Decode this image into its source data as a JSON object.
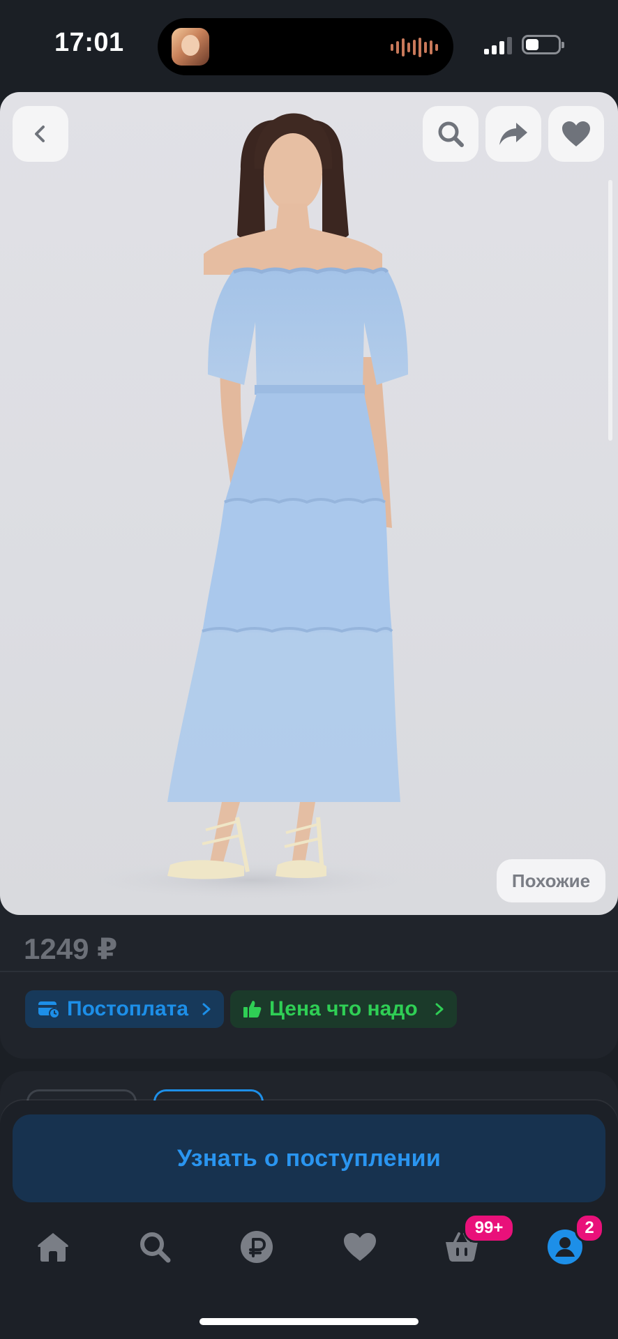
{
  "status_bar": {
    "time": "17:01"
  },
  "product": {
    "price": "1249 ₽",
    "similar_label": "Похожие"
  },
  "pills": {
    "postpay_label": "Постоплата",
    "good_price_label": "Цена что надо"
  },
  "actions": {
    "notify_label": "Узнать о поступлении"
  },
  "tab_bar": {
    "items": [
      {
        "name": "home",
        "icon": "home-icon"
      },
      {
        "name": "search",
        "icon": "search-icon"
      },
      {
        "name": "ruble",
        "icon": "ruble-icon"
      },
      {
        "name": "favorites",
        "icon": "heart-icon"
      },
      {
        "name": "cart",
        "icon": "basket-icon",
        "badge": "99+"
      },
      {
        "name": "profile",
        "icon": "profile-icon",
        "badge": "2"
      }
    ]
  },
  "colors": {
    "background": "#1b1f25",
    "accent_blue": "#1d8fe8",
    "accent_green": "#2fcf55",
    "badge_pink": "#e9117a",
    "dress_blue": "#a9c7ea"
  }
}
